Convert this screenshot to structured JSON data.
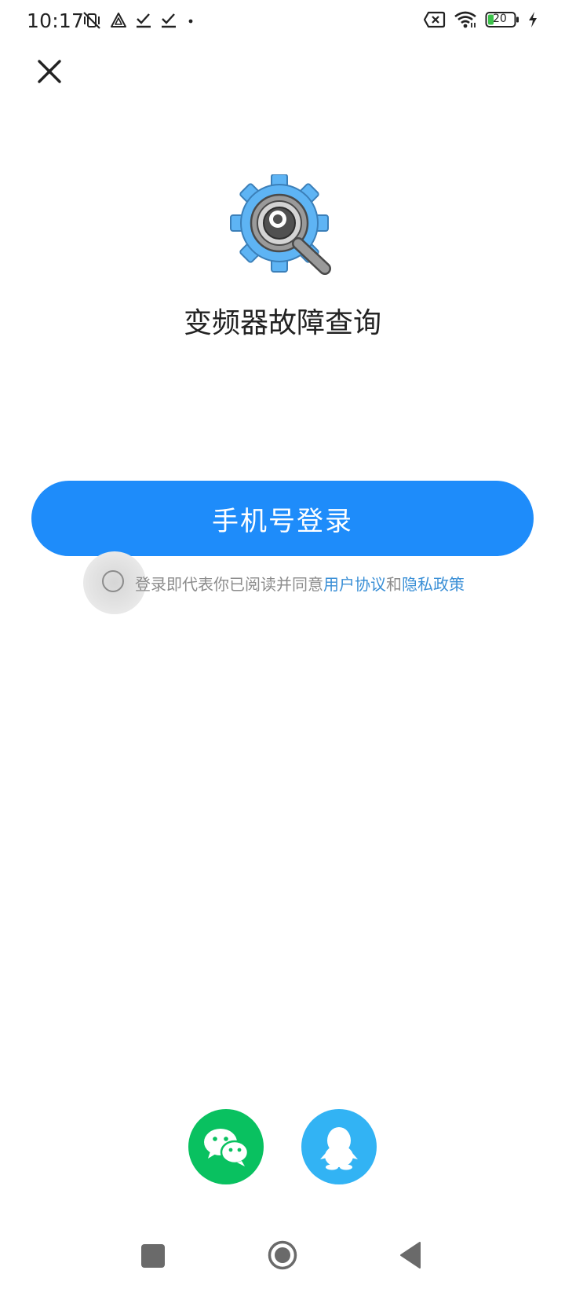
{
  "status_bar": {
    "time": "10:17",
    "battery_level": "20",
    "left_icons": [
      "mute-vibrate-icon",
      "navigation-icon",
      "check-download-icon",
      "check-download-icon",
      "dot-icon"
    ],
    "right_icons": [
      "no-sim-icon",
      "wifi-icon",
      "battery-icon",
      "charging-icon"
    ]
  },
  "app": {
    "title": "变频器故障查询",
    "logo_icon": "gear-magnifier-icon"
  },
  "login": {
    "phone_button_label": "手机号登录",
    "agreement_prefix": "登录即代表你已阅读并同意",
    "user_agreement_link": "用户协议",
    "conjunction": "和",
    "privacy_policy_link": "隐私政策",
    "agree_checked": false
  },
  "social_login": {
    "wechat_icon": "wechat-icon",
    "qq_icon": "qq-icon"
  },
  "colors": {
    "primary": "#1e8cfa",
    "link": "#3a8fd6",
    "wechat": "#09c160",
    "qq": "#32b3f4"
  }
}
